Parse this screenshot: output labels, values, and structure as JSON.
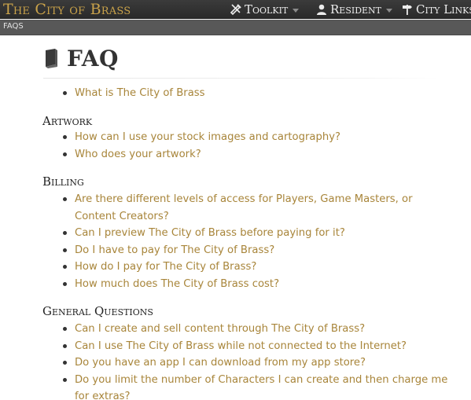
{
  "header": {
    "brand": "The City of Brass",
    "nav": [
      {
        "label": "Toolkit",
        "icon": "tools-icon"
      },
      {
        "label": "Resident",
        "icon": "user-icon"
      },
      {
        "label": "City Links",
        "icon": "signpost-icon"
      }
    ]
  },
  "breadcrumb": {
    "current": "FAQS"
  },
  "page": {
    "title": "FAQ"
  },
  "intro_items": [
    "What is The City of Brass"
  ],
  "sections": [
    {
      "heading": "Artwork",
      "items": [
        "How can I use your stock images and cartography?",
        "Who does your artwork?"
      ]
    },
    {
      "heading": "Billing",
      "items": [
        "Are there different levels of access for Players, Game Masters, or Content Creators?",
        "Can I preview The City of Brass before paying for it?",
        "Do I have to pay for The City of Brass?",
        "How do I pay for The City of Brass?",
        "How much does The City of Brass cost?"
      ]
    },
    {
      "heading": "General Questions",
      "items": [
        "Can I create and sell content through The City of Brass?",
        "Can I use The City of Brass while not connected to the Internet?",
        "Do you have an app I can download from my app store?",
        "Do you limit the number of Characters I can create and then charge me for extras?"
      ]
    }
  ],
  "colors": {
    "brand": "#c9a24a",
    "link": "#a8853a",
    "topbar": "#333333",
    "crumbbar": "#585858"
  }
}
